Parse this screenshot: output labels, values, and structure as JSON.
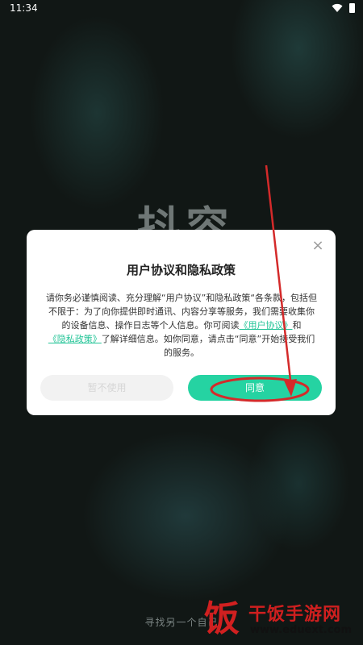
{
  "status_bar": {
    "time": "11:34",
    "icons": [
      "wifi-icon",
      "battery-icon"
    ]
  },
  "app": {
    "brand_text": "抖容",
    "footer_text": "寻找另一个自己"
  },
  "dialog": {
    "title": "用户协议和隐私政策",
    "close_glyph": "×",
    "body_part1": "请你务必谨慎阅读、充分理解“用户协议”和隐私政策“各条款，包括但不限于：为了向你提供即时通讯、内容分享等服务，我们需要收集你的设备信息、操作日志等个人信息。你可阅读",
    "link_user_agreement": "《用户协议》",
    "body_and": "和",
    "link_privacy_policy": "《隐私政策》",
    "body_part2": "了解详细信息。如你同意，请点击“同意”开始接受我们的服务。",
    "decline_label": "暂不使用",
    "agree_label": "同意"
  },
  "watermark": {
    "logo_char": "饭",
    "name": "干饭手游网",
    "url": "www.eduext.com"
  },
  "colors": {
    "accent": "#25d3a2",
    "link": "#23c497",
    "annotation": "#d42a2a",
    "background": "#111715"
  }
}
